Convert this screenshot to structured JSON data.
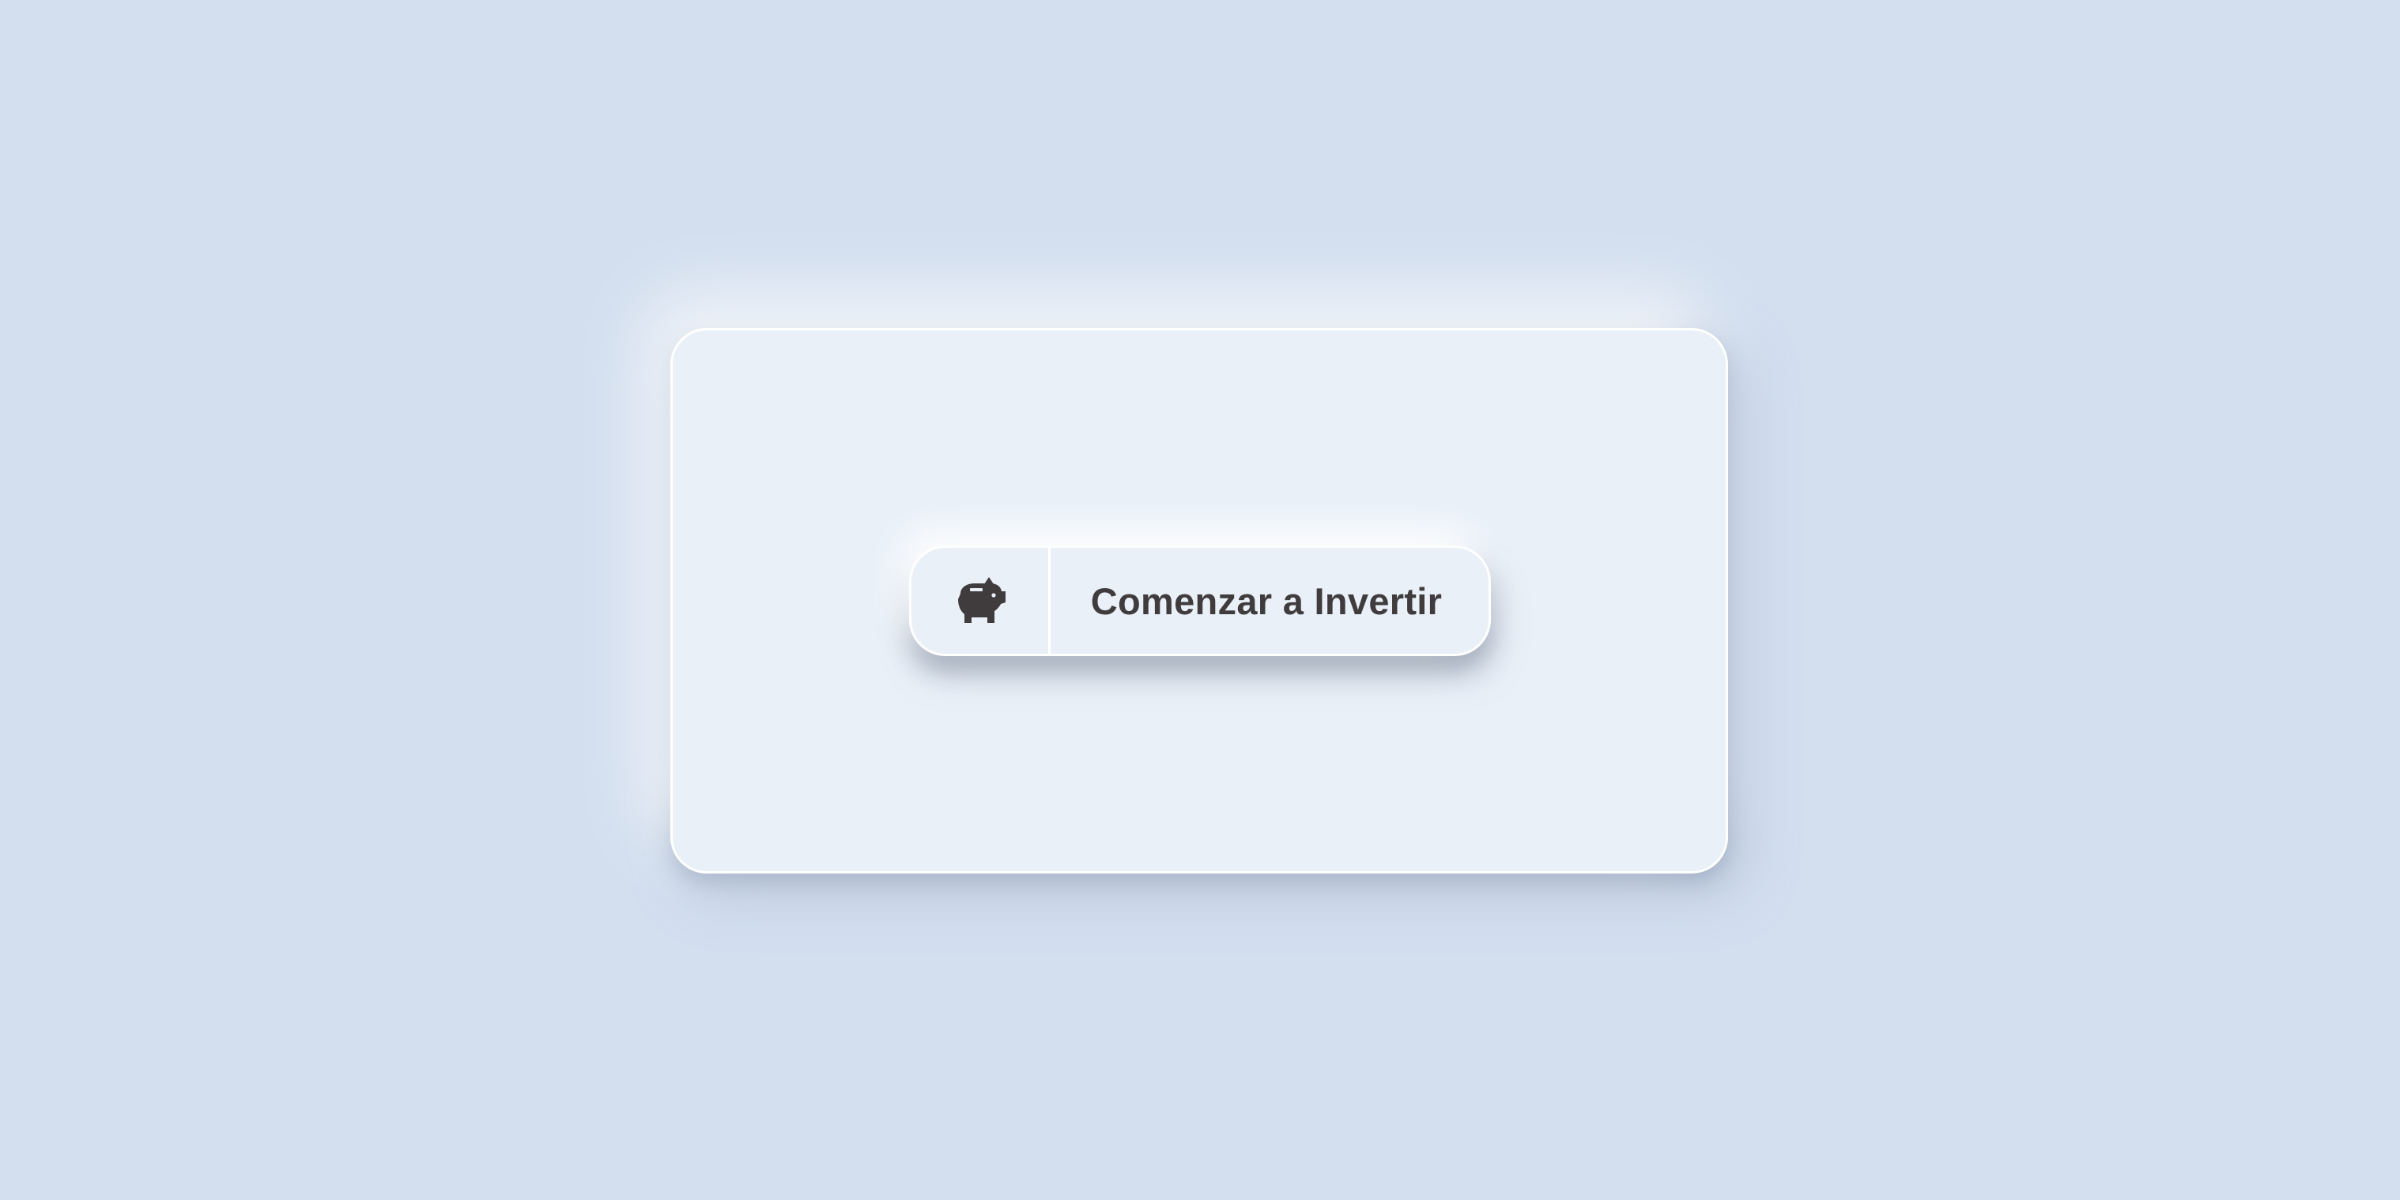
{
  "cta": {
    "label": "Comenzar a Invertir",
    "icon": "piggy-bank-icon",
    "text_color": "#403c3d",
    "icon_color": "#403c3d"
  },
  "colors": {
    "background": "#d3dfef",
    "card": "#e9f0f8",
    "border": "#ffffff"
  }
}
